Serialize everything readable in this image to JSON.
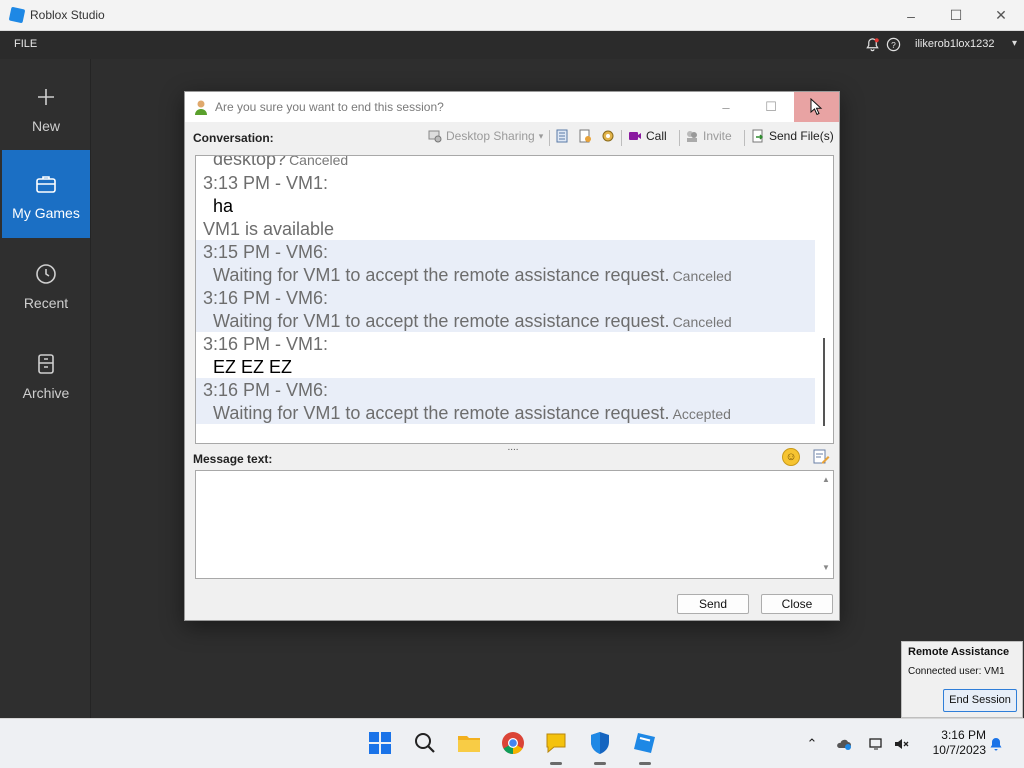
{
  "app": {
    "title": "Roblox Studio",
    "menu_file": "FILE",
    "username": "ilikerob1lox1232"
  },
  "sidebar": {
    "items": [
      {
        "label": "New",
        "icon": "plus-icon"
      },
      {
        "label": "My Games",
        "icon": "briefcase-icon",
        "active": true
      },
      {
        "label": "Recent",
        "icon": "clock-icon"
      },
      {
        "label": "Archive",
        "icon": "archive-icon"
      }
    ]
  },
  "dialog": {
    "title": "Are you sure you want to end this session?",
    "conversation_label": "Conversation:",
    "toolbar": {
      "desktop_sharing": "Desktop Sharing",
      "call": "Call",
      "invite": "Invite",
      "send_files": "Send File(s)"
    },
    "messages": [
      {
        "head": "desktop?",
        "status": "Canceled",
        "partial": true
      },
      {
        "head": "3:13 PM - VM1:",
        "body": "ha"
      },
      {
        "head": "VM1 is available"
      },
      {
        "head": "3:15 PM - VM6:",
        "body": "Waiting for VM1 to accept the remote assistance request.",
        "status": "Canceled"
      },
      {
        "head": "3:16 PM - VM6:",
        "body": "Waiting for VM1 to accept the remote assistance request.",
        "status": "Canceled"
      },
      {
        "head": "3:16 PM - VM1:",
        "body": "EZ EZ EZ"
      },
      {
        "head": "3:16 PM - VM6:",
        "body": "Waiting for VM1 to accept the remote assistance request.",
        "status": "Accepted"
      }
    ],
    "splitter": "....",
    "message_label": "Message text:",
    "message_value": "",
    "send_label": "Send",
    "close_label": "Close"
  },
  "remote_assistance": {
    "title": "Remote Assistance",
    "connected_user": "Connected user:  VM1",
    "end_session": "End Session"
  },
  "taskbar": {
    "time": "3:16 PM",
    "date": "10/7/2023"
  }
}
